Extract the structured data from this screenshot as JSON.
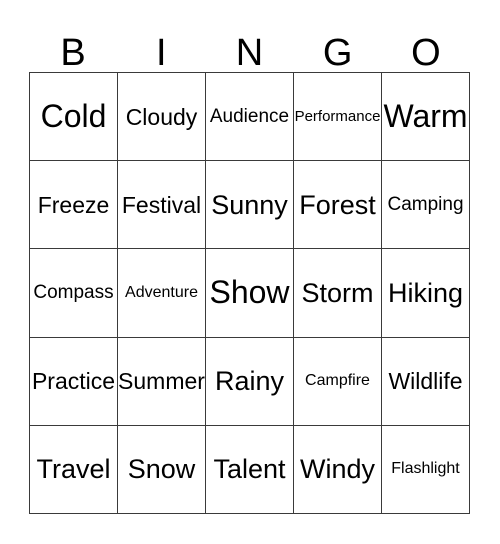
{
  "card": {
    "type": "bingo-card",
    "background_color": "#ffffff",
    "text_color": "#000000",
    "grid_line_color": "#3a3a3a",
    "columns": 5,
    "rows": 5
  },
  "header": {
    "letters": [
      "B",
      "I",
      "N",
      "G",
      "O"
    ]
  },
  "grid": {
    "rows": [
      {
        "cells": [
          {
            "text": "Cold",
            "size": "fs-xl"
          },
          {
            "text": "Cloudy",
            "size": "fs-md"
          },
          {
            "text": "Audience",
            "size": "fs-sm"
          },
          {
            "text": "Performance",
            "size": "fs-xxs"
          },
          {
            "text": "Warm",
            "size": "fs-xl"
          }
        ]
      },
      {
        "cells": [
          {
            "text": "Freeze",
            "size": "fs-md"
          },
          {
            "text": "Festival",
            "size": "fs-md"
          },
          {
            "text": "Sunny",
            "size": "fs-lg"
          },
          {
            "text": "Forest",
            "size": "fs-lg"
          },
          {
            "text": "Camping",
            "size": "fs-sm"
          }
        ]
      },
      {
        "cells": [
          {
            "text": "Compass",
            "size": "fs-sm"
          },
          {
            "text": "Adventure",
            "size": "fs-xs"
          },
          {
            "text": "Show",
            "size": "fs-xl"
          },
          {
            "text": "Storm",
            "size": "fs-lg"
          },
          {
            "text": "Hiking",
            "size": "fs-lg"
          }
        ]
      },
      {
        "cells": [
          {
            "text": "Practice",
            "size": "fs-md"
          },
          {
            "text": "Summer",
            "size": "fs-md"
          },
          {
            "text": "Rainy",
            "size": "fs-lg"
          },
          {
            "text": "Campfire",
            "size": "fs-xs"
          },
          {
            "text": "Wildlife",
            "size": "fs-md"
          }
        ]
      },
      {
        "cells": [
          {
            "text": "Travel",
            "size": "fs-lg"
          },
          {
            "text": "Snow",
            "size": "fs-lg"
          },
          {
            "text": "Talent",
            "size": "fs-lg"
          },
          {
            "text": "Windy",
            "size": "fs-lg"
          },
          {
            "text": "Flashlight",
            "size": "fs-xs"
          }
        ]
      }
    ]
  }
}
